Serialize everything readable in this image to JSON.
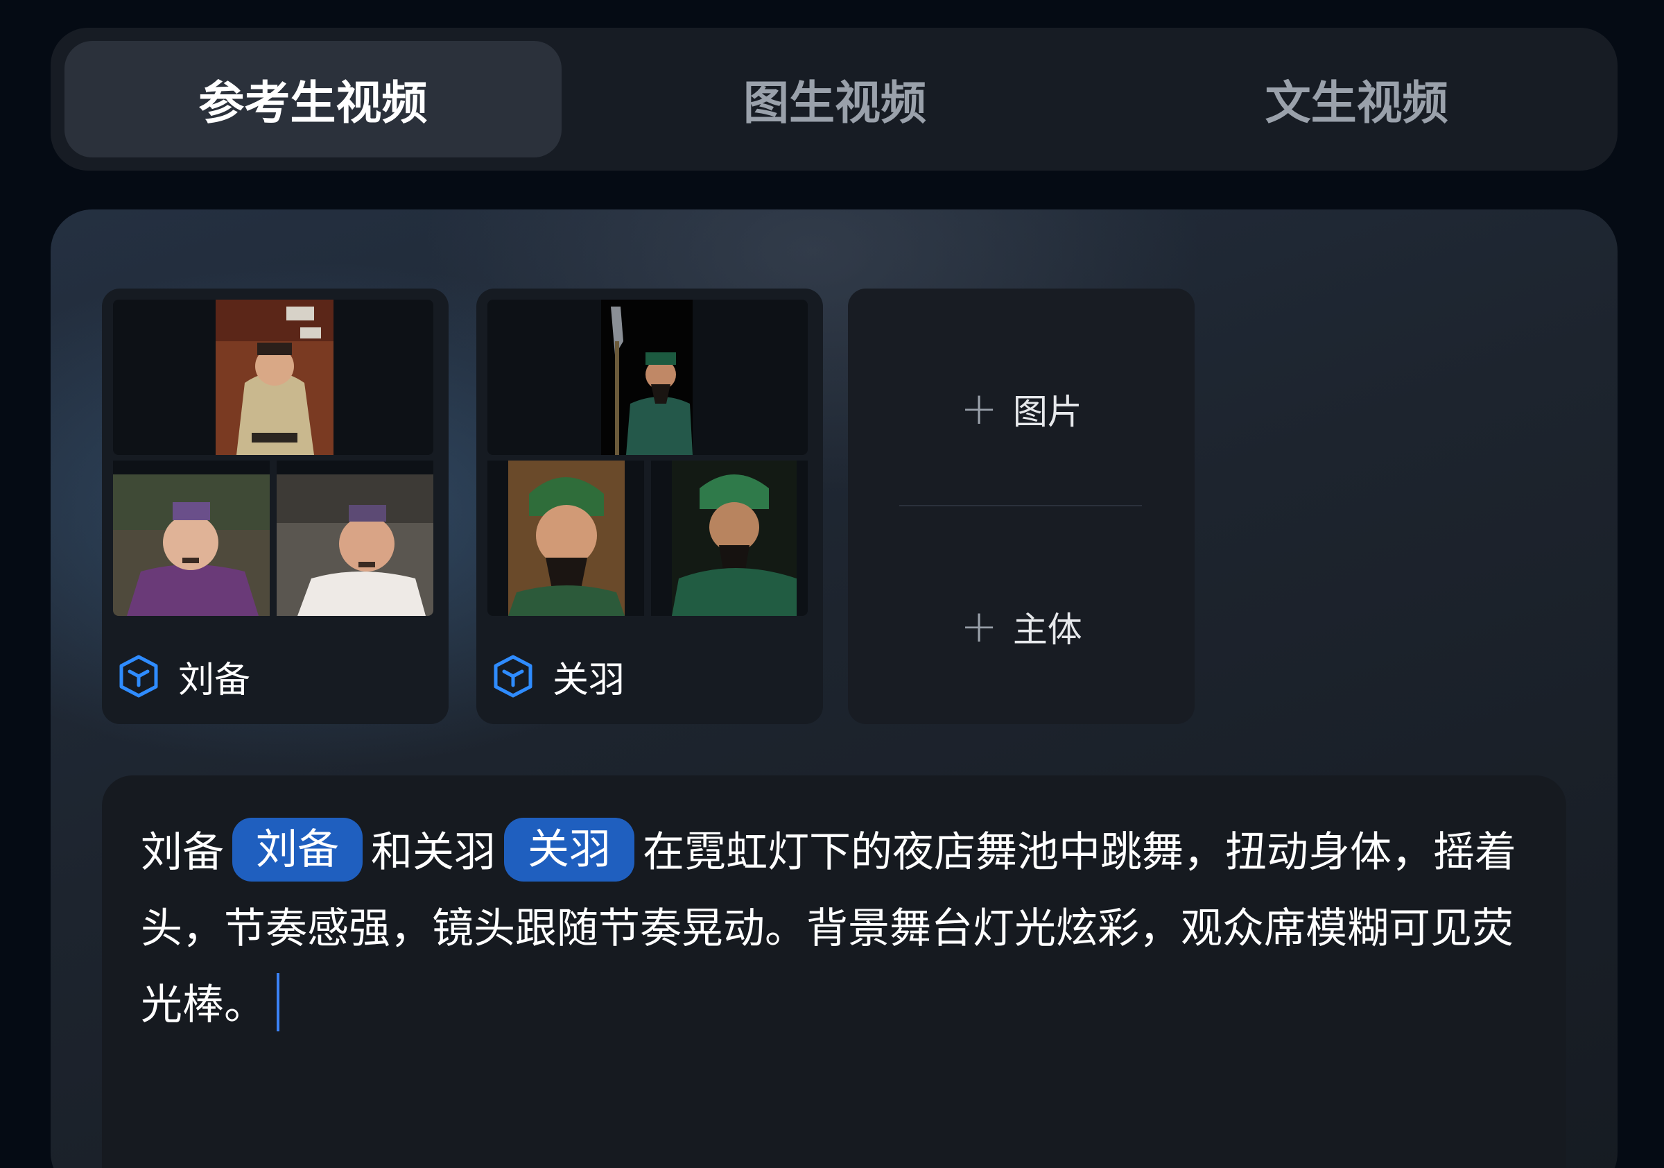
{
  "tabs": [
    {
      "label": "参考生视频",
      "active": true
    },
    {
      "label": "图生视频",
      "active": false
    },
    {
      "label": "文生视频",
      "active": false
    }
  ],
  "subjects": [
    {
      "name": "刘备",
      "icon": "cube-icon"
    },
    {
      "name": "关羽",
      "icon": "cube-icon"
    }
  ],
  "add_card": {
    "image_label": "图片",
    "subject_label": "主体"
  },
  "prompt": {
    "prefix_1": "刘备",
    "tag_1": "刘备",
    "mid_1": "和关羽",
    "tag_2": "关羽",
    "rest": "在霓虹灯下的夜店舞池中跳舞，扭动身体，摇着头，节奏感强，镜头跟随节奏晃动。背景舞台灯光炫彩，观众席模糊可见荧光棒。"
  },
  "colors": {
    "accent": "#1f5fbf",
    "icon_blue": "#2f8cff",
    "caret": "#3b82f6"
  }
}
